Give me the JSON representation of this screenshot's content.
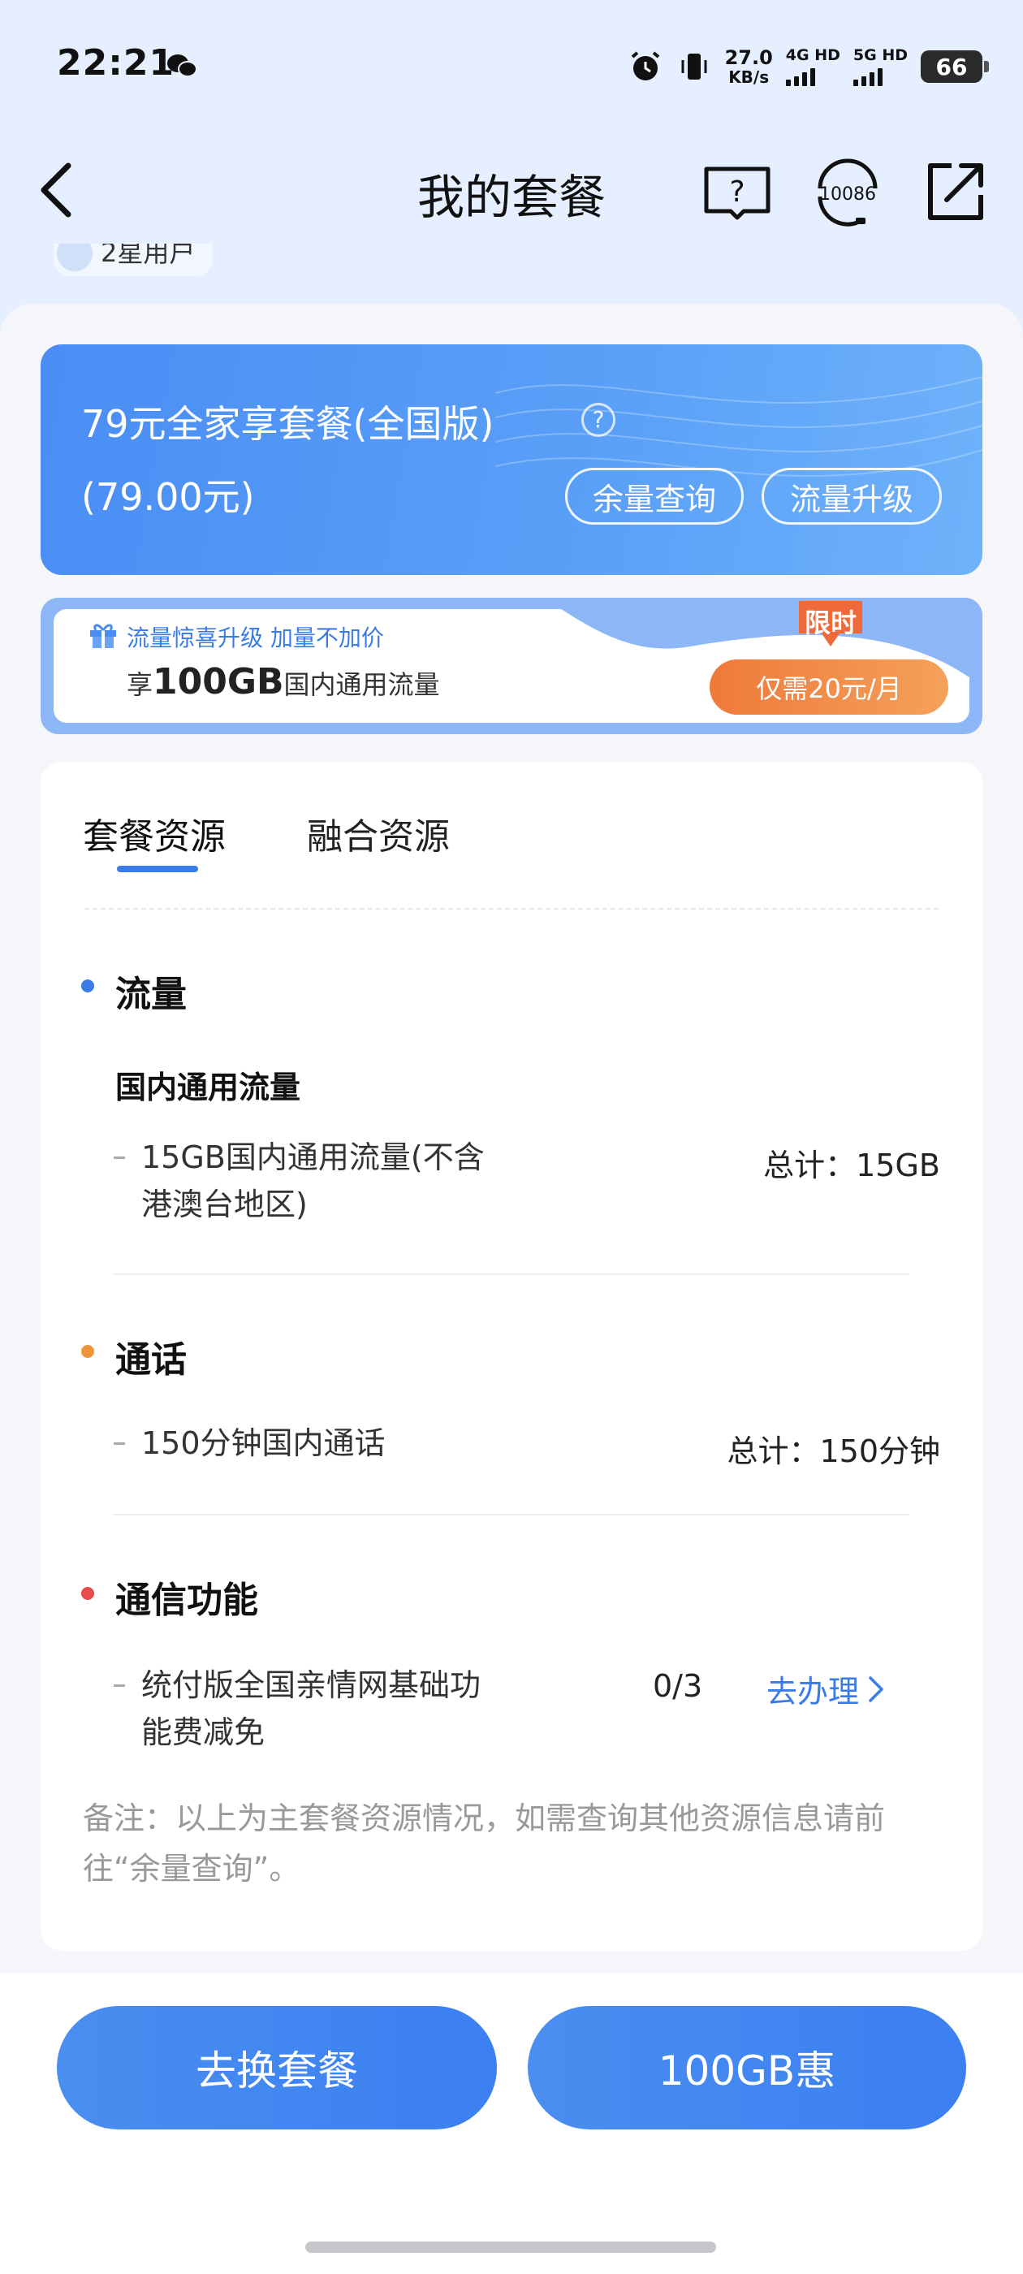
{
  "status_bar": {
    "time": "22:21",
    "net_speed_value": "27.0",
    "net_speed_unit": "KB/s",
    "signal_1_label": "4G HD",
    "signal_2_label": "5G HD",
    "battery": "66",
    "icons": [
      "wechat-icon",
      "alarm-icon",
      "vibrate-icon",
      "signal-icon",
      "battery-icon"
    ]
  },
  "nav": {
    "title": "我的套餐",
    "service_number": "10086",
    "icons": [
      "back-icon",
      "help-book-icon",
      "customer-service-icon",
      "share-icon"
    ]
  },
  "peek_text": "2星用户",
  "plan": {
    "name": "79元全家享套餐(全国版)",
    "price": "(79.00元)",
    "help_symbol": "?",
    "balance_button": "余量查询",
    "upgrade_button": "流量升级",
    "gradient_colors": [
      "#4a8df5",
      "#6fb2fb"
    ]
  },
  "promo": {
    "sub_text": "流量惊喜升级 加量不加价",
    "main_prefix": "享",
    "main_highlight": "100GB",
    "main_suffix": "国内通用流量",
    "tag": "限时",
    "price_button": "仅需20元/月",
    "accent_color": "#ef7a39"
  },
  "resources": {
    "tabs": [
      {
        "label": "套餐资源",
        "active": true
      },
      {
        "label": "融合资源",
        "active": false
      }
    ],
    "sections": {
      "data": {
        "title": "流量",
        "dot_color": "#3a7be8",
        "subtitle": "国内通用流量",
        "item_line1": "15GB国内通用流量(不含",
        "item_line2": "港澳台地区)",
        "total": "总计：15GB"
      },
      "voice": {
        "title": "通话",
        "dot_color": "#f0943a",
        "item": "150分钟国内通话",
        "total": "总计：150分钟"
      },
      "features": {
        "title": "通信功能",
        "dot_color": "#e94c4c",
        "item_line1": "统付版全国亲情网基础功",
        "item_line2": "能费减免",
        "count": "0/3",
        "action": "去办理"
      }
    },
    "note": "备注：以上为主套餐资源情况，如需查询其他资源信息请前往“余量查询”。"
  },
  "bottom": {
    "change_plan": "去换套餐",
    "offer": "100GB惠"
  }
}
